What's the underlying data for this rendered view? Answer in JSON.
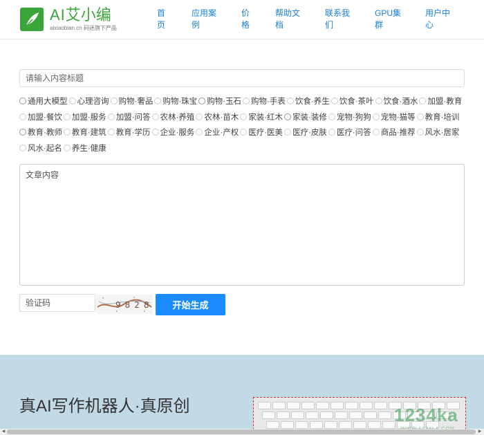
{
  "header": {
    "brand_prefix": "AI",
    "brand_name": "艾小编",
    "brand_domain": "aixiaobian.cn",
    "brand_tagline": "码迷旗下产品",
    "nav": [
      {
        "line1": "首",
        "line2": "页"
      },
      {
        "line1": "应用案",
        "line2": "例"
      },
      {
        "line1": "价",
        "line2": "格"
      },
      {
        "line1": "帮助文",
        "line2": "档"
      },
      {
        "line1": "联系我",
        "line2": "们"
      },
      {
        "line1": "GPU集",
        "line2": "群"
      },
      {
        "line1": "用户中",
        "line2": "心"
      }
    ]
  },
  "form": {
    "title_placeholder": "请输入内容标题",
    "models": [
      "通用大模型",
      "心理咨询",
      "购物·奢品",
      "购物·珠宝",
      "购物·玉石",
      "购物·手表",
      "饮食·养生",
      "饮食·茶叶",
      "饮食·酒水",
      "加盟·教育",
      "加盟·餐饮",
      "加盟·服务",
      "加盟·问答",
      "农林·养殖",
      "农林·苗木",
      "家装·红木",
      "家装·装修",
      "宠物·狗狗",
      "宠物·猫等",
      "教育·培训",
      "教育·教师",
      "教育·建筑",
      "教育·学历",
      "企业·服务",
      "企业·产权",
      "医疗·医美",
      "医疗·皮肤",
      "医疗·问答",
      "商品·推荐",
      "风水·居家",
      "风水·起名",
      "养生·健康"
    ],
    "content_placeholder": "文章内容",
    "captcha_placeholder": "验证码",
    "captcha_text": "9828",
    "generate_label": "开始生成"
  },
  "hero": {
    "title": "真AI写作机器人·真原创",
    "watermark": "1234ka",
    "watermark_sub": "WWW.1234LA.COM"
  },
  "colors": {
    "brand_green": "#3aa63a",
    "nav_blue": "#1a7fd4",
    "button_blue": "#1a8cff",
    "hero_bg": "#c2d9e6"
  }
}
